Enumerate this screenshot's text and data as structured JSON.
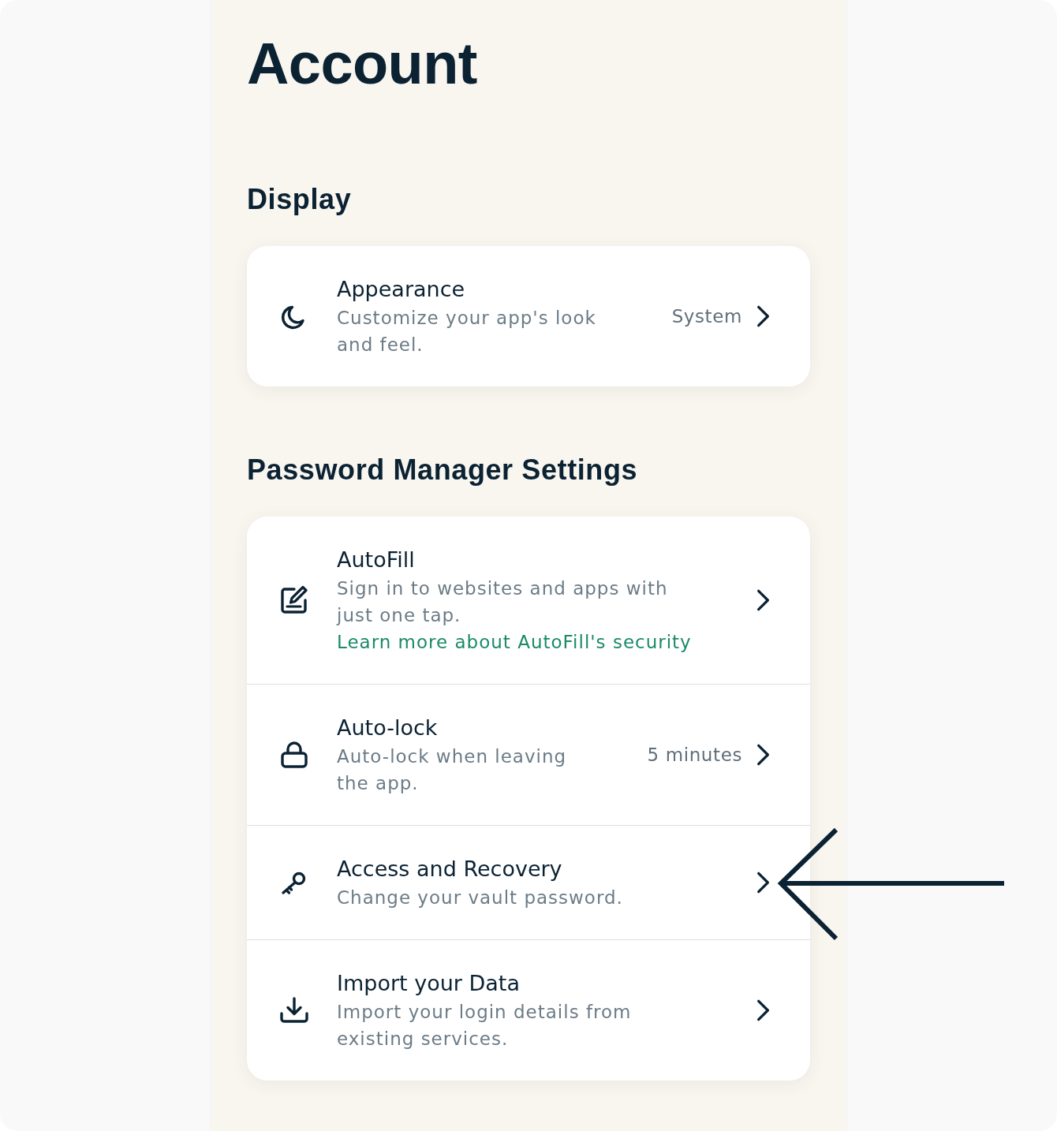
{
  "page": {
    "title": "Account"
  },
  "sections": [
    {
      "heading": "Display",
      "rows": [
        {
          "title": "Appearance",
          "description": "Customize your app's look and feel.",
          "value": "System"
        }
      ]
    },
    {
      "heading": "Password Manager Settings",
      "rows": [
        {
          "title": "AutoFill",
          "description": "Sign in to websites and apps with just one tap.",
          "link": "Learn more about AutoFill's security"
        },
        {
          "title": "Auto-lock",
          "description": "Auto-lock when leaving the app.",
          "value": "5 minutes"
        },
        {
          "title": "Access and Recovery",
          "description": "Change your vault password."
        },
        {
          "title": "Import your Data",
          "description": "Import your login details from existing services."
        }
      ]
    }
  ]
}
